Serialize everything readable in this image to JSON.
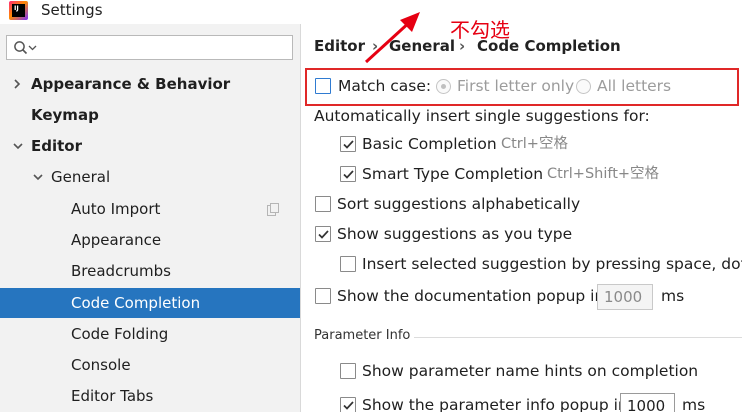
{
  "window": {
    "title": "Settings",
    "app_icon_text": "IJ"
  },
  "sidebar": {
    "search": {
      "placeholder": "",
      "value": ""
    },
    "items": [
      {
        "label": "Appearance & Behavior",
        "expanded": false
      },
      {
        "label": "Keymap"
      },
      {
        "label": "Editor",
        "expanded": true
      },
      {
        "label": "General",
        "expanded": true
      },
      {
        "label": "Auto Import"
      },
      {
        "label": "Appearance"
      },
      {
        "label": "Breadcrumbs"
      },
      {
        "label": "Code Completion",
        "selected": true
      },
      {
        "label": "Code Folding"
      },
      {
        "label": "Console"
      },
      {
        "label": "Editor Tabs"
      }
    ]
  },
  "breadcrumb": {
    "items": [
      "Editor",
      "General",
      "Code Completion"
    ],
    "separator": "›"
  },
  "settings": {
    "match_case": {
      "label": "Match case:",
      "checked": false,
      "options": [
        "First letter only",
        "All letters"
      ],
      "selected_option": "First letter only",
      "disabled": true
    },
    "auto_insert_label": "Automatically insert single suggestions for:",
    "basic_completion": {
      "label": "Basic Completion",
      "shortcut": "Ctrl+空格",
      "checked": true
    },
    "smart_type_completion": {
      "label": "Smart Type Completion",
      "shortcut": "Ctrl+Shift+空格",
      "checked": true
    },
    "sort_alphabetically": {
      "label": "Sort suggestions alphabetically",
      "checked": false
    },
    "show_as_you_type": {
      "label": "Show suggestions as you type",
      "checked": true
    },
    "insert_by_space": {
      "label": "Insert selected suggestion by pressing space, dot, or",
      "checked": false
    },
    "show_doc_popup": {
      "label": "Show the documentation popup in",
      "value": "1000",
      "unit": "ms",
      "checked": false
    },
    "parameter_info": {
      "section_title": "Parameter Info",
      "show_name_hints": {
        "label": "Show parameter name hints on completion",
        "checked": false
      },
      "show_info_popup": {
        "label": "Show the parameter info popup in",
        "value": "1000",
        "unit": "ms",
        "checked": true
      }
    }
  },
  "annotation": {
    "text": "不勾选",
    "color": "#e60012"
  },
  "colors": {
    "selection": "#2675bf",
    "sidebar_bg": "#f2f2f2",
    "annotation_box": "#e02828"
  }
}
